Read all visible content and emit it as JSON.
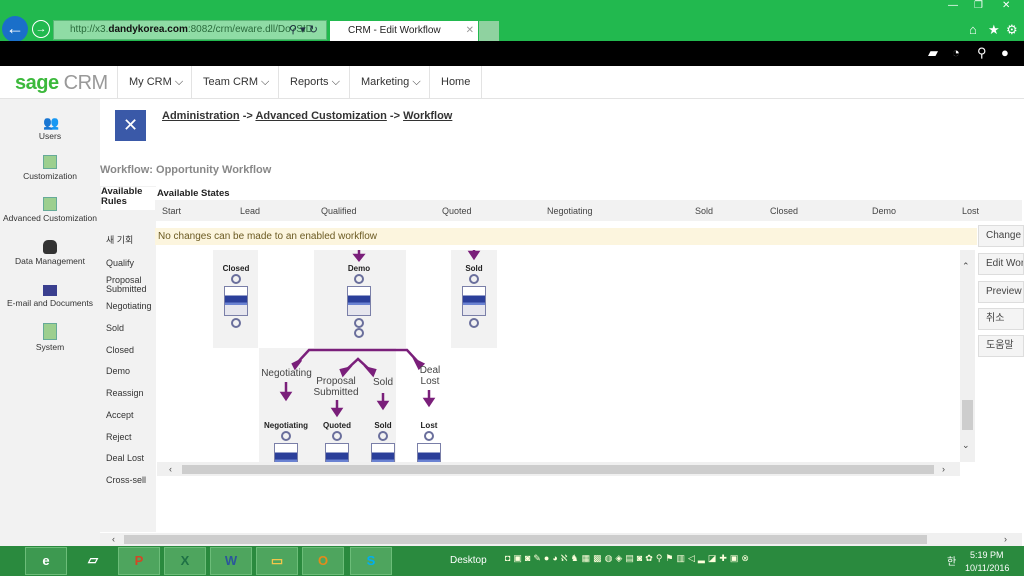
{
  "browser": {
    "url_prefix": "http://x3.",
    "url_domain": "dandykorea.com",
    "url_rest": ":8082/crm/eware.dll/Do?SID",
    "tab_title": "CRM - Edit Workflow",
    "tab_favicon": "sage"
  },
  "app": {
    "logo_sage": "sage",
    "logo_crm": "CRM"
  },
  "nav": [
    {
      "label": "My CRM ⌵"
    },
    {
      "label": "Team CRM ⌵"
    },
    {
      "label": "Reports ⌵"
    },
    {
      "label": "Marketing ⌵"
    },
    {
      "label": "Home"
    }
  ],
  "sidebar": [
    {
      "label": "Users",
      "icon": "users-icon"
    },
    {
      "label": "Customization",
      "icon": "customization-icon"
    },
    {
      "label": "Advanced Customization",
      "icon": "advanced-customization-icon"
    },
    {
      "label": "Data Management",
      "icon": "database-icon"
    },
    {
      "label": "E-mail and Documents",
      "icon": "envelope-icon"
    },
    {
      "label": "System",
      "icon": "system-icon"
    }
  ],
  "breadcrumb": {
    "items": [
      "Administration",
      "Advanced Customization",
      "Workflow"
    ],
    "sep": "->"
  },
  "workflow_title": "Workflow: Opportunity Workflow",
  "rules": {
    "heading": "Available Rules",
    "items": [
      "새 기회",
      "Qualify",
      "Proposal Submitted",
      "Negotiating",
      "Sold",
      "Closed",
      "Demo",
      "Reassign",
      "Accept",
      "Reject",
      "Deal Lost",
      "Cross-sell"
    ]
  },
  "states": {
    "heading": "Available States",
    "items": [
      "Start",
      "Lead",
      "Qualified",
      "Quoted",
      "Negotiating",
      "Sold",
      "Closed",
      "Demo",
      "Lost"
    ]
  },
  "notice": "No changes can be made to an enabled workflow",
  "diagram": {
    "top_states": [
      "Closed",
      "Demo",
      "Sold"
    ],
    "transitions": [
      "Negotiating",
      "Proposal Submitted",
      "Sold",
      "Deal Lost"
    ],
    "bottom_states": [
      "Negotiating",
      "Quoted",
      "Sold",
      "Lost"
    ],
    "accent": "#7a1f7a"
  },
  "actions": [
    "Change",
    "Edit Workflow",
    "Preview",
    "취소",
    "도움말"
  ],
  "taskbar": {
    "desktop": "Desktop",
    "time": "5:19 PM",
    "date": "10/11/2016",
    "ime": "한"
  },
  "colors": {
    "browser": "#22b94f",
    "taskbar": "#2a8a3e",
    "sage_green": "#3cb93c",
    "header_icon": "#3a59a8"
  }
}
